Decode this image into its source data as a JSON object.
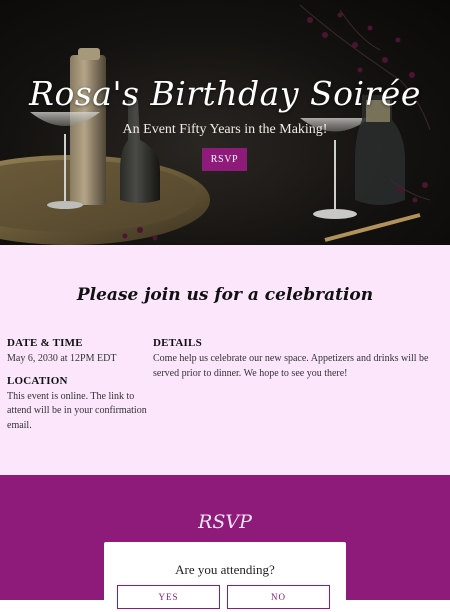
{
  "hero": {
    "title": "Rosa's Birthday Soirée",
    "subtitle": "An Event Fifty Years in the Making!",
    "rsvp_button": "RSVP"
  },
  "invite": {
    "heading": "Please join us for a celebration",
    "date_label": "DATE & TIME",
    "date_value": "May 6, 2030 at 12PM EDT",
    "location_label": "LOCATION",
    "location_value": "This event is online. The link to attend will be in your confirmation email.",
    "details_label": "DETAILS",
    "details_value": "Come help us celebrate our new space. Appetizers and drinks will be served prior to dinner. We hope to see you there!"
  },
  "rsvp": {
    "heading": "RSVP",
    "question": "Are you attending?",
    "yes_label": "YES",
    "no_label": "NO"
  },
  "colors": {
    "accent": "#8e1a7a",
    "info_background": "#fbe6fb",
    "hero_background": "#141210"
  }
}
